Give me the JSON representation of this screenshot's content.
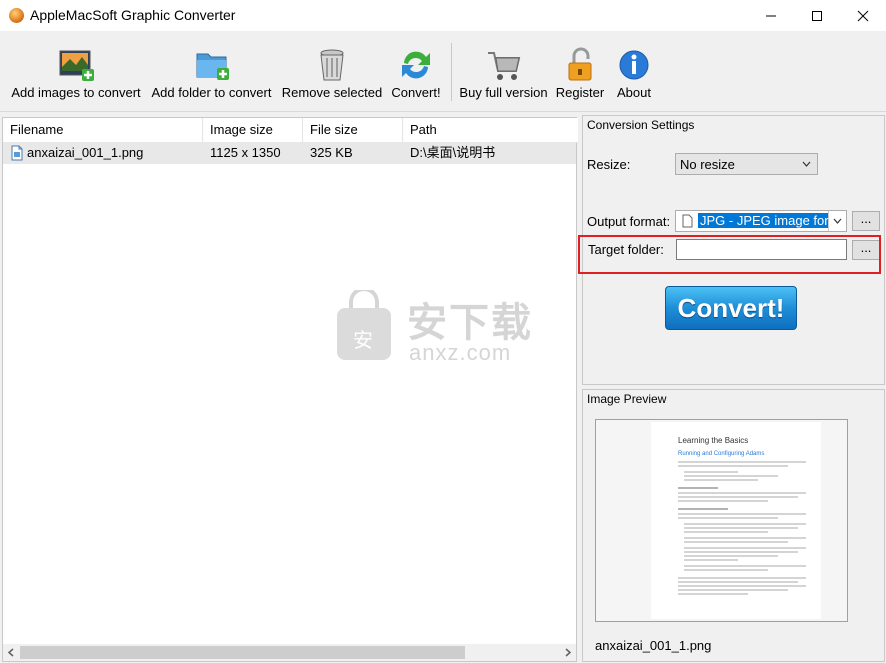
{
  "window": {
    "title": "AppleMacSoft Graphic Converter",
    "minimize_glyph": "—",
    "maximize_glyph": "☐",
    "close_glyph": "✕"
  },
  "toolbar": {
    "items": [
      {
        "label": "Add images to convert",
        "icon": "add-images-icon"
      },
      {
        "label": "Add folder to convert",
        "icon": "add-folder-icon"
      },
      {
        "label": "Remove selected",
        "icon": "trash-icon"
      },
      {
        "label": "Convert!",
        "icon": "convert-arrows-icon"
      },
      {
        "label": "Buy full version",
        "icon": "cart-icon"
      },
      {
        "label": "Register",
        "icon": "lock-icon"
      },
      {
        "label": "About",
        "icon": "info-icon"
      }
    ]
  },
  "file_list": {
    "columns": [
      "Filename",
      "Image size",
      "File size",
      "Path"
    ],
    "rows": [
      {
        "filename": "anxaizai_001_1.png",
        "image_size": "1125 x 1350",
        "file_size": "325 KB",
        "path": "D:\\桌面\\说明书"
      }
    ]
  },
  "watermark": {
    "text": "安下载",
    "subtext": "anxz.com",
    "badge": "安"
  },
  "settings": {
    "title": "Conversion Settings",
    "resize_label": "Resize:",
    "resize_value": "No resize",
    "output_format_label": "Output format:",
    "output_format_value": "JPG - JPEG image format",
    "target_folder_label": "Target folder:",
    "target_folder_value": "",
    "browse_label": "...",
    "convert_label": "Convert!"
  },
  "preview": {
    "title": "Image Preview",
    "filename": "anxaizai_001_1.png",
    "doc_heading": "Learning the Basics",
    "doc_subheading": "Running and Configuring Adams"
  },
  "colors": {
    "highlight_border": "#e02020",
    "convert_button": "#1e8fd8",
    "selected_format_bg": "#0078d7"
  }
}
